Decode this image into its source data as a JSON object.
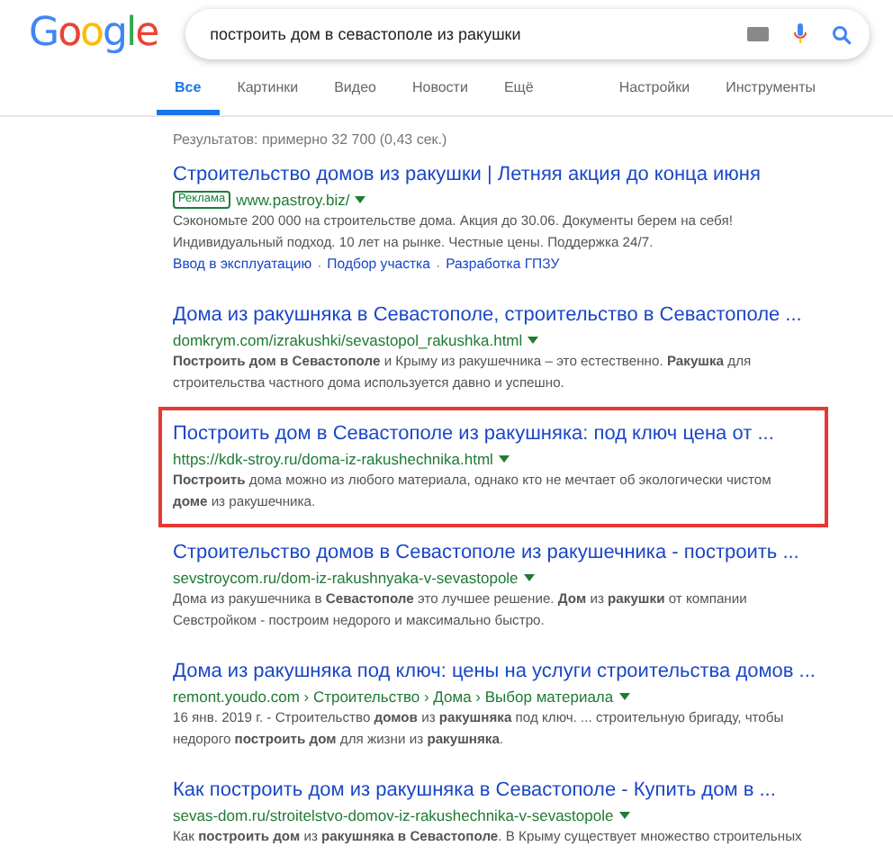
{
  "logo": "Google",
  "search": {
    "value": "построить дом в севастополе из ракушки"
  },
  "tabs": [
    {
      "label": "Все",
      "selected": true
    },
    {
      "label": "Картинки",
      "selected": false
    },
    {
      "label": "Видео",
      "selected": false
    },
    {
      "label": "Новости",
      "selected": false
    },
    {
      "label": "Ещё",
      "selected": false
    }
  ],
  "tools": [
    "Настройки",
    "Инструменты"
  ],
  "stats": "Результатов: примерно 32 700 (0,43 сек.)",
  "results": [
    {
      "kind": "ad",
      "highlighted": false,
      "title": "Строительство домов из ракушки | Летняя акция до конца июня",
      "badge": "Реклама",
      "url": "www.pastroy.biz/",
      "snippet": [
        "Сэкономьте 200 000 на строительстве дома. Акция до 30.06. Документы берем на себя!",
        "Индивидуальный подход. 10 лет на рынке. Честные цены. Поддержка 24/7."
      ],
      "sitelinks": [
        "Ввод в эксплуатацию",
        "Подбор участка",
        "Разработка ГПЗУ"
      ],
      "sitelink_separator": "·"
    },
    {
      "kind": "organic",
      "highlighted": false,
      "title": "Дома из ракушняка в Севастополе, строительство в Севастополе ...",
      "url": "domkrym.com/izrakushki/sevastopol_rakushka.html",
      "snippet": [
        "**Построить дом в Севастополе** и Крыму из ракушечника – это естественно. **Ракушка** для",
        "строительства частного дома используется давно и успешно."
      ]
    },
    {
      "kind": "organic",
      "highlighted": true,
      "title": "Построить дом в Севастополе из ракушняка: под ключ цена от ...",
      "url": "https://kdk-stroy.ru/doma-iz-rakushechnika.html",
      "snippet": [
        "**Построить** дома можно из любого материала, однако кто не мечтает об экологически чистом",
        "**доме** из ракушечника."
      ]
    },
    {
      "kind": "organic",
      "highlighted": false,
      "title": "Строительство домов в Севастополе из ракушечника - построить ...",
      "url": "sevstroycom.ru/dom-iz-rakushnyaka-v-sevastopole",
      "snippet": [
        "Дома из ракушечника в **Севастополе** это лучшее решение. **Дом** из **ракушки** от компании",
        "Севстройком - построим недорого и максимально быстро."
      ]
    },
    {
      "kind": "organic",
      "highlighted": false,
      "title": "Дома из ракушняка под ключ: цены на услуги строительства домов ...",
      "url": "remont.youdo.com › Строительство › Дома › Выбор материала",
      "date": "16 янв. 2019 г. -",
      "snippet": [
        "Строительство **домов** из **ракушняка** под ключ. ... строительную бригаду, чтобы",
        "недорого **построить дом** для жизни из **ракушняка**."
      ]
    },
    {
      "kind": "organic",
      "highlighted": false,
      "title": "Как построить дом из ракушняка в Севастополе - Купить дом в ...",
      "url": "sevas-dom.ru/stroitelstvo-domov-iz-rakushechnika-v-sevastopole",
      "snippet": [
        "Как **построить дом** из **ракушняка в Севастополе**. В Крыму существует множество строительных"
      ]
    }
  ]
}
